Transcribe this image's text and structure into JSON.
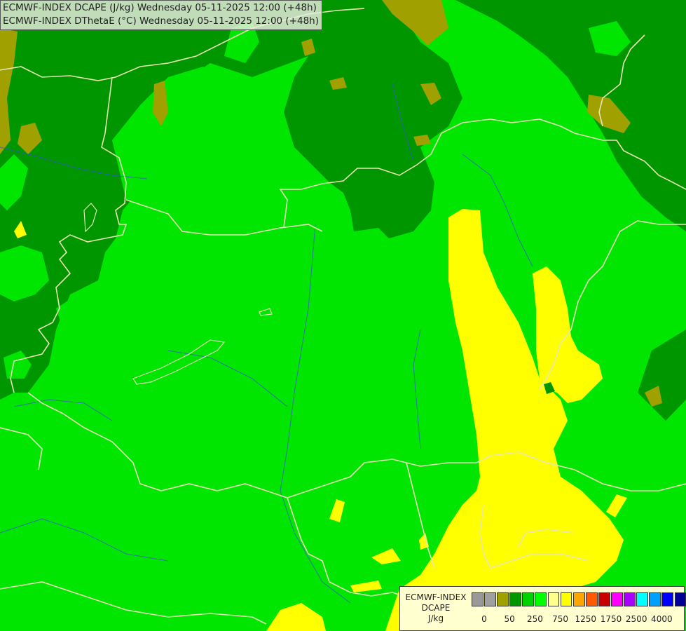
{
  "header": {
    "line1": "ECMWF-INDEX DCAPE (J/kg) Wednesday 05-11-2025 12:00 (+48h)",
    "line2": "ECMWF-INDEX DThetaE (°C) Wednesday 05-11-2025 12:00 (+48h)"
  },
  "legend": {
    "title_line1": "ECMWF-INDEX",
    "title_line2": "DCAPE",
    "unit": "J/kg",
    "colors": [
      "#999999",
      "#a0a0a0",
      "#a0a000",
      "#009600",
      "#00d200",
      "#00ff00",
      "#ffff8c",
      "#ffff00",
      "#ffa500",
      "#ff5a00",
      "#c80000",
      "#ff00ff",
      "#aa00ff",
      "#00ffff",
      "#00a0ff",
      "#0000ff",
      "#000096"
    ],
    "tick_labels": [
      "0",
      "50",
      "250",
      "750",
      "1250",
      "1750",
      "2500",
      "4000"
    ]
  },
  "map": {
    "palette": {
      "bright_green": "#00e600",
      "dark_green": "#009600",
      "olive": "#a0a000",
      "yellow": "#ffff00",
      "border": "#e6e6b4",
      "river": "#3c50dc"
    }
  }
}
